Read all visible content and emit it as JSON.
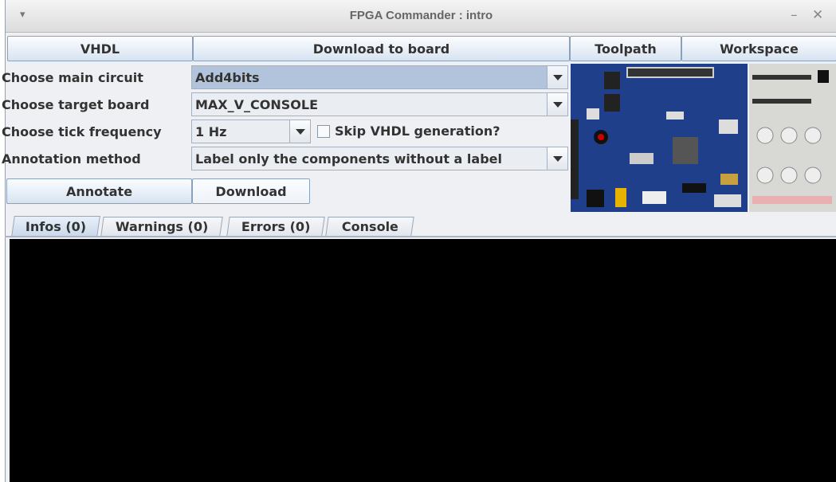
{
  "window": {
    "title": "FPGA Commander : intro",
    "minimize": "–",
    "close": "✕",
    "menu": "▾"
  },
  "header": {
    "vhdl": "VHDL",
    "download_to_board": "Download to board",
    "toolpath": "Toolpath",
    "workspace": "Workspace"
  },
  "form": {
    "main_circuit": {
      "label": "Choose main circuit",
      "value": "Add4bits"
    },
    "target_board": {
      "label": "Choose target board",
      "value": "MAX_V_CONSOLE"
    },
    "tick_frequency": {
      "label": "Choose tick frequency",
      "value": "1 Hz"
    },
    "skip_vhdl": {
      "label": "Skip VHDL generation?",
      "checked": false
    },
    "annotation": {
      "label": "Annotation method",
      "value": "Label only the components without a label"
    }
  },
  "actions": {
    "annotate": "Annotate",
    "download": "Download"
  },
  "tabs": [
    {
      "label": "Infos (0)",
      "active": true
    },
    {
      "label": "Warnings (0)",
      "active": false
    },
    {
      "label": "Errors (0)",
      "active": false
    },
    {
      "label": "Console",
      "active": false
    }
  ],
  "colors": {
    "console_bg": "#000000",
    "board_bg": "#1f3f8a",
    "button_gradient_bottom": "#d7e3f1"
  }
}
